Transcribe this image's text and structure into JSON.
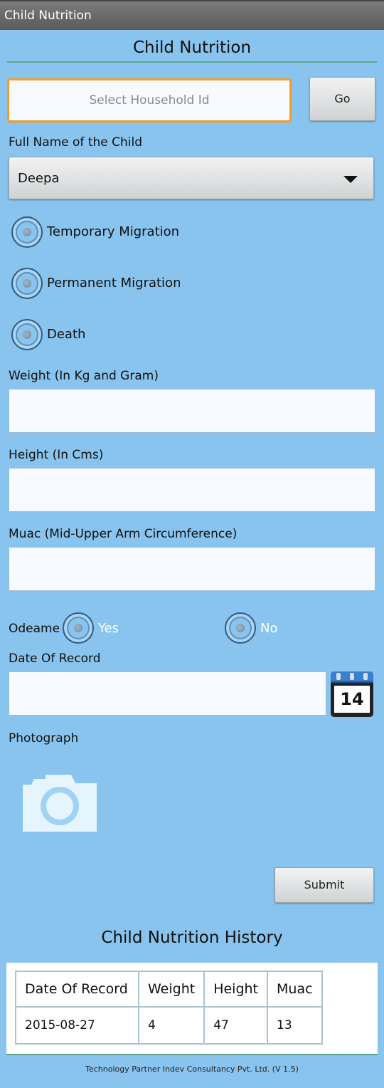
{
  "app": {
    "title": "Child Nutrition"
  },
  "form": {
    "heading": "Child Nutrition",
    "household": {
      "placeholder": "Select Household Id",
      "go_label": "Go"
    },
    "child_name": {
      "label": "Full Name of the Child",
      "selected": "Deepa"
    },
    "status_options": [
      "Temporary Migration",
      "Permanent Migration",
      "Death"
    ],
    "weight": {
      "label": "Weight (In Kg and Gram)",
      "value": ""
    },
    "height": {
      "label": "Height (In Cms)",
      "value": ""
    },
    "muac": {
      "label": "Muac (Mid-Upper Arm Circumference)",
      "value": ""
    },
    "odeame": {
      "label": "Odeame",
      "yes": "Yes",
      "no": "No"
    },
    "date_of_record": {
      "label": "Date Of Record",
      "value": "",
      "calendar_day": "14"
    },
    "photograph": {
      "label": "Photograph"
    },
    "submit_label": "Submit"
  },
  "history": {
    "title": "Child Nutrition History",
    "columns": [
      "Date Of Record",
      "Weight",
      "Height",
      "Muac"
    ],
    "rows": [
      [
        "2015-08-27",
        "4",
        "47",
        "13"
      ]
    ]
  },
  "footer": {
    "text": "Technology Partner Indev Consultancy Pvt. Ltd. (V 1.5)"
  },
  "colors": {
    "background": "#89c4ef",
    "focus_border": "#f39b27",
    "divider": "#5aa78c"
  },
  "icons": {
    "calendar": "calendar-icon",
    "camera": "camera-icon",
    "dropdown": "chevron-down-icon"
  }
}
